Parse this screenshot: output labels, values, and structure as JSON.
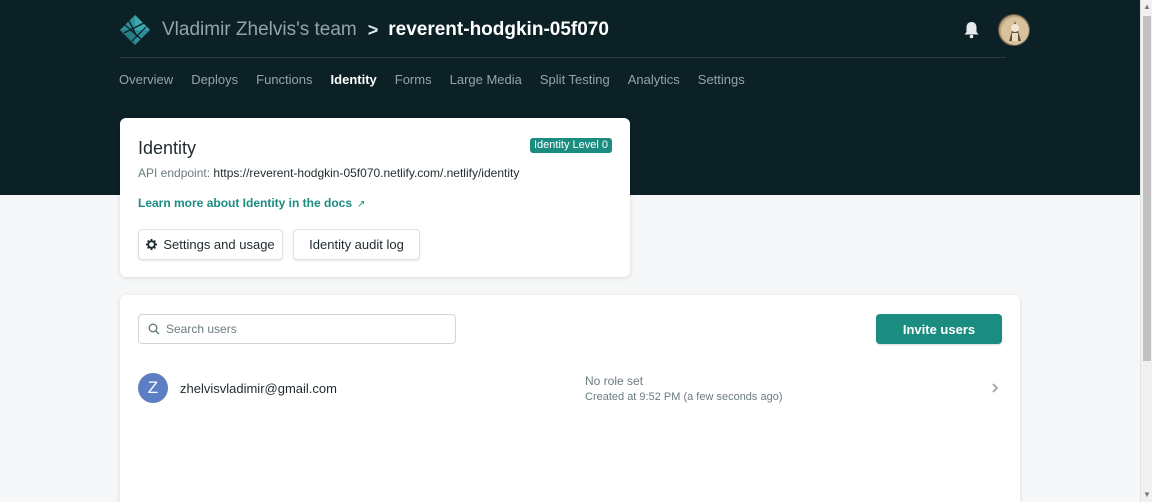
{
  "header": {
    "team_name": "Vladimir Zhelvis's team",
    "separator": ">",
    "site_name": "reverent-hodgkin-05f070",
    "logo_icon": "netlify-logo-icon",
    "bell_icon": "bell-icon",
    "avatar_icon": "user-avatar-icon"
  },
  "tabs": [
    {
      "label": "Overview"
    },
    {
      "label": "Deploys"
    },
    {
      "label": "Functions"
    },
    {
      "label": "Identity",
      "active": true
    },
    {
      "label": "Forms"
    },
    {
      "label": "Large Media"
    },
    {
      "label": "Split Testing"
    },
    {
      "label": "Analytics"
    },
    {
      "label": "Settings"
    }
  ],
  "identity": {
    "title": "Identity",
    "badge": "Identity Level 0",
    "api_label": "API endpoint: ",
    "api_url": "https://reverent-hodgkin-05f070.netlify.com/.netlify/identity",
    "docs_link": "Learn more about Identity in the docs",
    "docs_icon": "external-link-icon",
    "settings_button": "Settings and usage",
    "settings_icon": "gear-icon",
    "audit_button": "Identity audit log"
  },
  "users": {
    "search_placeholder": "Search users",
    "search_value": "",
    "invite_button": "Invite users",
    "list": [
      {
        "initial": "Z",
        "email": "zhelvisvladimir@gmail.com",
        "role": "No role set",
        "created": "Created at 9:52 PM (a few seconds ago)"
      }
    ]
  },
  "colors": {
    "header_bg": "#0b2126",
    "accent": "#1a8c80",
    "user_avatar": "#5c7ec3",
    "page_bg": "#f5f7f8"
  }
}
